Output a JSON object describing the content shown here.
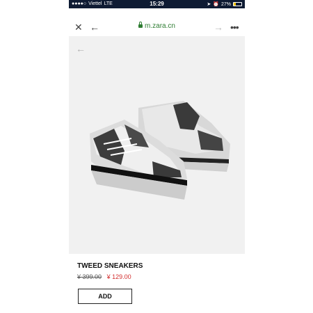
{
  "status_bar": {
    "signal_dots": "●●●●○",
    "carrier": "Viettel",
    "network": "LTE",
    "time": "15:29",
    "battery_text": "27%",
    "battery_level": 0.27,
    "battery_color": "#f2c200"
  },
  "browser": {
    "close_icon": "close-icon",
    "back_icon": "arrow-left-icon",
    "url": "m.zara.cn",
    "forward_icon": "arrow-right-icon",
    "menu_icon": "more-icon",
    "url_color": "#2e7d32"
  },
  "product": {
    "title": "TWEED SNEAKERS",
    "old_price": "¥ 399.00",
    "new_price": "¥ 129.00",
    "add_label": "ADD",
    "price_color": "#d32f2f"
  }
}
